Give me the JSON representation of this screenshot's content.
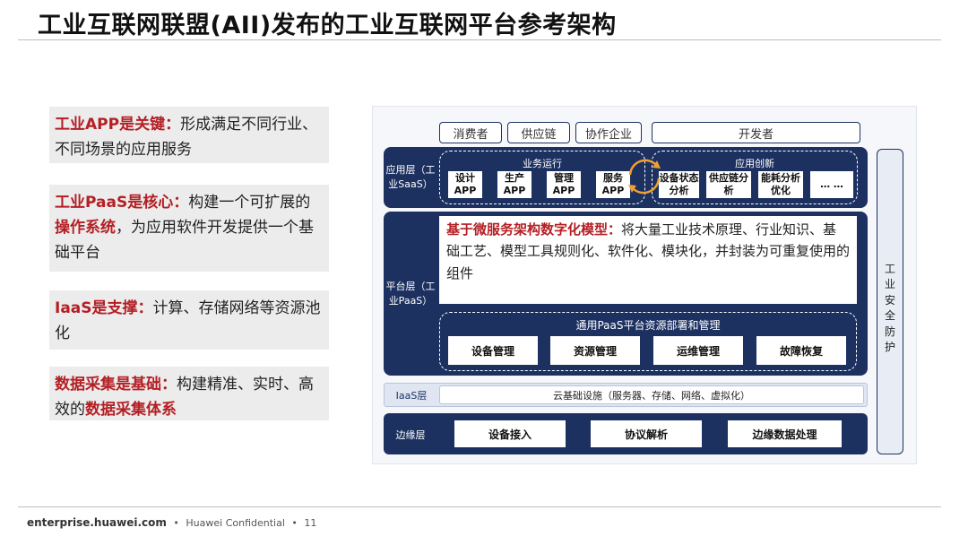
{
  "title": "工业互联网联盟(AII)发布的工业互联网平台参考架构",
  "left_boxes": [
    {
      "key": "工业APP是关键",
      "colon": "：",
      "text": "形成满足不同行业、不同场景的应用服务"
    },
    {
      "key": "工业PaaS是核心",
      "colon": "：",
      "text_a": "构建一个可扩展的",
      "bold": "操作系统",
      "text_b": "，为应用软件开发提供一个基础平台"
    },
    {
      "key": "IaaS是支撑",
      "colon": "：",
      "text": "计算、存储网络等资源池化"
    },
    {
      "key": "数据采集是基础",
      "colon": "：",
      "text_a": "构建精准、实时、高效的",
      "red": "数据采集体系"
    }
  ],
  "diagram": {
    "top_pills": [
      "消费者",
      "供应链",
      "协作企业",
      "开发者"
    ],
    "app_layer": {
      "label": "应用层（工业SaaS）",
      "group1_title": "业务运行",
      "group1_items": [
        "设计APP",
        "生产APP",
        "管理APP",
        "服务APP"
      ],
      "group2_title": "应用创新",
      "group2_items": [
        "设备状态分析",
        "供应链分析",
        "能耗分析优化",
        "… …"
      ]
    },
    "platform_layer": {
      "label": "平台层（工业PaaS）",
      "callout_key": "基于微服务架构数字化模型",
      "callout_colon": "：",
      "callout_text": "将大量工业技术原理、行业知识、基础工艺、模型工具规则化、软件化、模块化，并封装为可重复使用的组件",
      "mgmt_title": "通用PaaS平台资源部署和管理",
      "mgmt_items": [
        "设备管理",
        "资源管理",
        "运维管理",
        "故障恢复"
      ]
    },
    "iaas_layer": {
      "label": "IaaS层",
      "content": "云基础设施（服务器、存储、网络、虚拟化）"
    },
    "edge_layer": {
      "label": "边缘层",
      "items": [
        "设备接入",
        "协议解析",
        "边缘数据处理"
      ]
    },
    "security": "工业安全防护"
  },
  "footer": {
    "site": "enterprise.huawei.com",
    "sep": "•",
    "confidential": "Huawei Confidential",
    "page": "11"
  }
}
